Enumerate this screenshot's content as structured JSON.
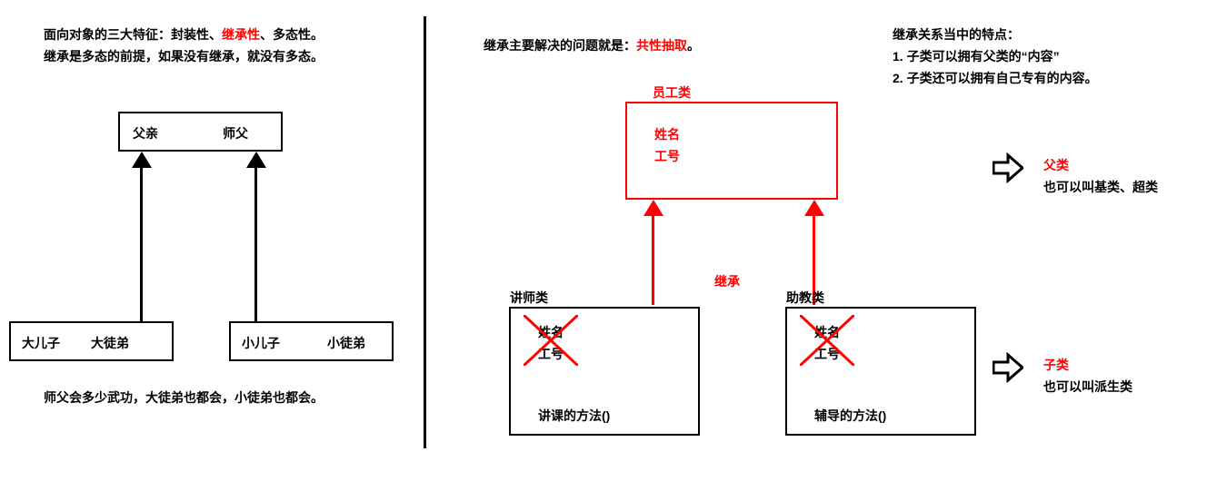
{
  "left": {
    "line1_a": "面向对象的三大特征：封装性、",
    "line1_b": "继承性",
    "line1_c": "、多态性。",
    "line2": "继承是多态的前提，如果没有继承，就没有多态。",
    "parent_box_left": "父亲",
    "parent_box_right": "师父",
    "child1_a": "大儿子",
    "child1_b": "大徒弟",
    "child2_a": "小儿子",
    "child2_b": "小徒弟",
    "bottom_line": "师父会多少武功，大徒弟也都会，小徒弟也都会。"
  },
  "mid": {
    "title_a": "继承主要解决的问题就是：",
    "title_b": "共性抽取",
    "title_c": "。",
    "employee_label": "员工类",
    "emp_f1": "姓名",
    "emp_f2": "工号",
    "inherit_label": "继承",
    "teacher_label": "讲师类",
    "teacher_f1": "姓名",
    "teacher_f2": "工号",
    "teacher_method": "讲课的方法()",
    "assistant_label": "助教类",
    "assistant_f1": "姓名",
    "assistant_f2": "工号",
    "assistant_method": "辅导的方法()"
  },
  "right": {
    "head1": "继承关系当中的特点：",
    "head2": "1. 子类可以拥有父类的“内容”",
    "head3": "2. 子类还可以拥有自己专有的内容。",
    "parent_label": "父类",
    "parent_sub": "也可以叫基类、超类",
    "child_label": "子类",
    "child_sub": "也可以叫派生类"
  }
}
